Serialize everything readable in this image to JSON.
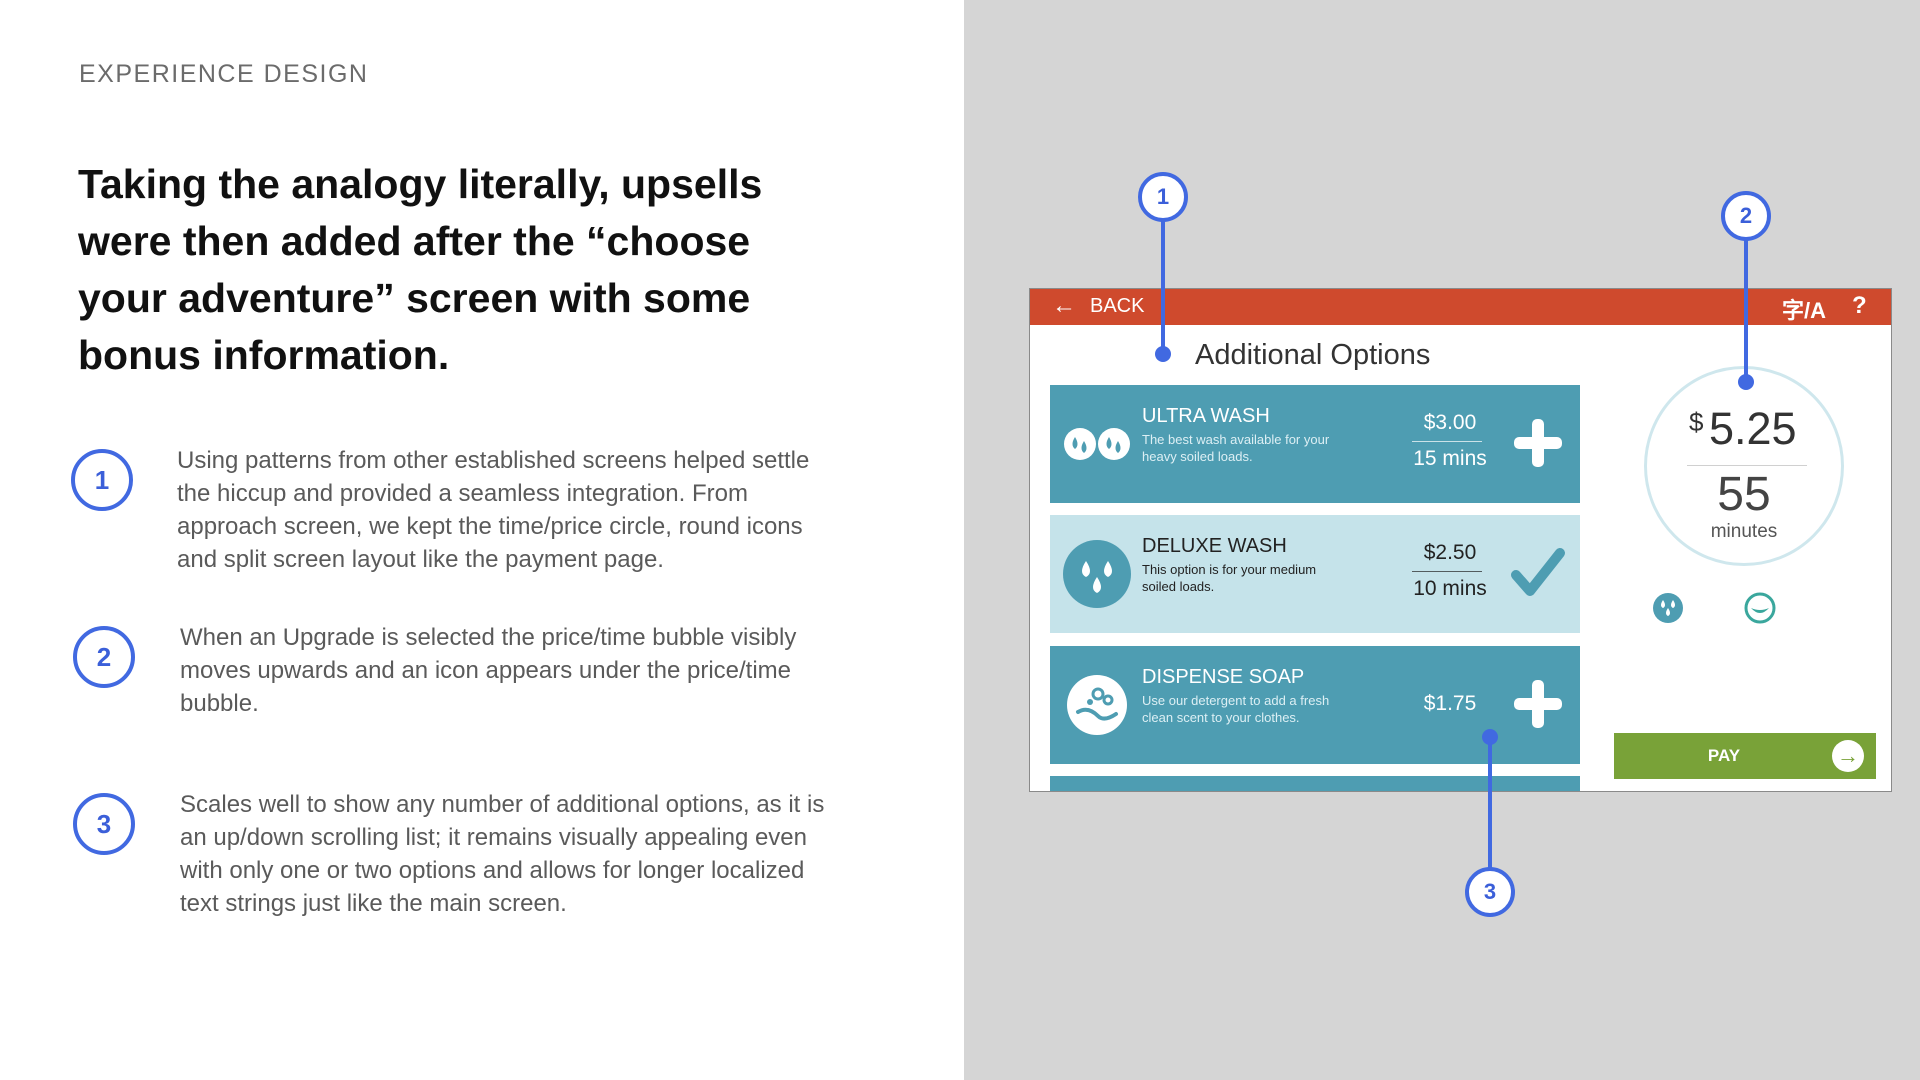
{
  "eyebrow": "EXPERIENCE DESIGN",
  "headline": "Taking the analogy literally, upsells were then added after the “choose your adventure” screen with some bonus information.",
  "points": [
    {
      "number": "1",
      "text": "Using patterns from other established screens helped settle the hiccup and provided a seamless integration. From approach screen, we kept the time/price circle, round icons and split screen layout like the payment page."
    },
    {
      "number": "2",
      "text": "When an Upgrade is selected the price/time bubble visibly moves upwards and an icon appears under the price/time bubble."
    },
    {
      "number": "3",
      "text": "Scales well to show any number of additional options, as it is an up/down scrolling list; it remains visually appealing even with only one or two options and allows for longer localized text strings just like the main screen."
    }
  ],
  "kiosk": {
    "back_label": "BACK",
    "help_label": "?",
    "title": "Additional Options",
    "options": [
      {
        "name": "ULTRA WASH",
        "description": "The best wash available for your heavy soiled loads.",
        "price": "$3.00",
        "time": "15 mins",
        "icon": "double-droplet-icon",
        "action": "add-plus-icon",
        "selected": false
      },
      {
        "name": "DELUXE WASH",
        "description": "This option is for your medium soiled loads.",
        "price": "$2.50",
        "time": "10 mins",
        "icon": "triple-droplet-icon",
        "action": "checkmark-icon",
        "selected": true
      },
      {
        "name": "DISPENSE SOAP",
        "description": "Use our detergent to add a fresh clean scent to your clothes.",
        "price": "$1.75",
        "time": "",
        "icon": "soap-bubbles-icon",
        "action": "add-plus-icon",
        "selected": false
      }
    ],
    "summary": {
      "currency": "$",
      "price": "5.25",
      "minutes": "55",
      "minutes_unit": "minutes"
    },
    "upgrade_icons": [
      "droplets-badge-icon",
      "soap-badge-icon"
    ],
    "pay_label": "PAY"
  },
  "callouts": [
    "1",
    "2",
    "3"
  ],
  "colors": {
    "accent_blue": "#4169e1",
    "topbar": "#cf4a2d",
    "teal": "#4e9db2",
    "light_teal": "#c5e3ea",
    "pay_green": "#79a238"
  }
}
